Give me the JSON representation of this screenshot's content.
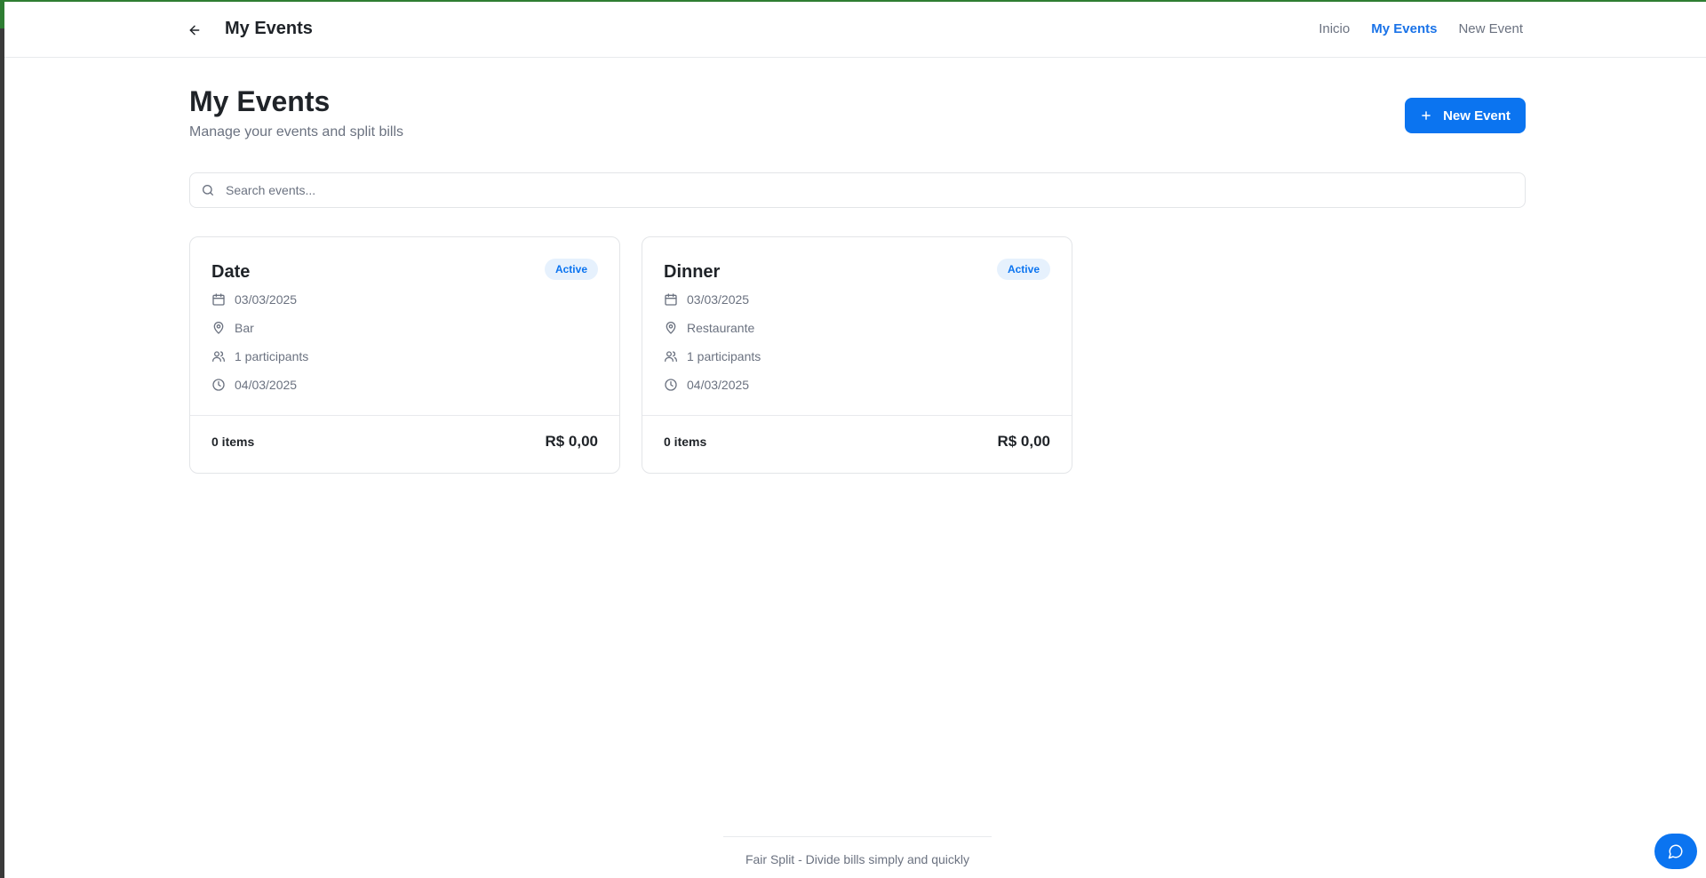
{
  "header": {
    "title": "My Events",
    "nav": [
      {
        "label": "Inicio"
      },
      {
        "label": "My Events"
      },
      {
        "label": "New Event"
      }
    ]
  },
  "page": {
    "title": "My Events",
    "subtitle": "Manage your events and split bills",
    "new_event_label": "New Event"
  },
  "search": {
    "placeholder": "Search events...",
    "value": ""
  },
  "events": [
    {
      "name": "Date",
      "status": "Active",
      "date": "03/03/2025",
      "location": "Bar",
      "participants": "1 participants",
      "created": "04/03/2025",
      "items": "0 items",
      "total": "R$ 0,00"
    },
    {
      "name": "Dinner",
      "status": "Active",
      "date": "03/03/2025",
      "location": "Restaurante",
      "participants": "1 participants",
      "created": "04/03/2025",
      "items": "0 items",
      "total": "R$ 0,00"
    }
  ],
  "footer": {
    "text": "Fair Split - Divide bills simply and quickly"
  },
  "icons": {
    "back": "arrow-left-icon",
    "plus": "plus-icon",
    "search": "search-icon",
    "calendar": "calendar-icon",
    "location": "map-pin-icon",
    "participants": "users-icon",
    "created": "clock-icon",
    "chat": "chat-bubble-icon"
  },
  "colors": {
    "accent": "#0b74f0",
    "badge_bg": "#e6f1fd",
    "muted_text": "#6b7280",
    "heading_text": "#1f2328",
    "border": "#e3e5e8"
  }
}
